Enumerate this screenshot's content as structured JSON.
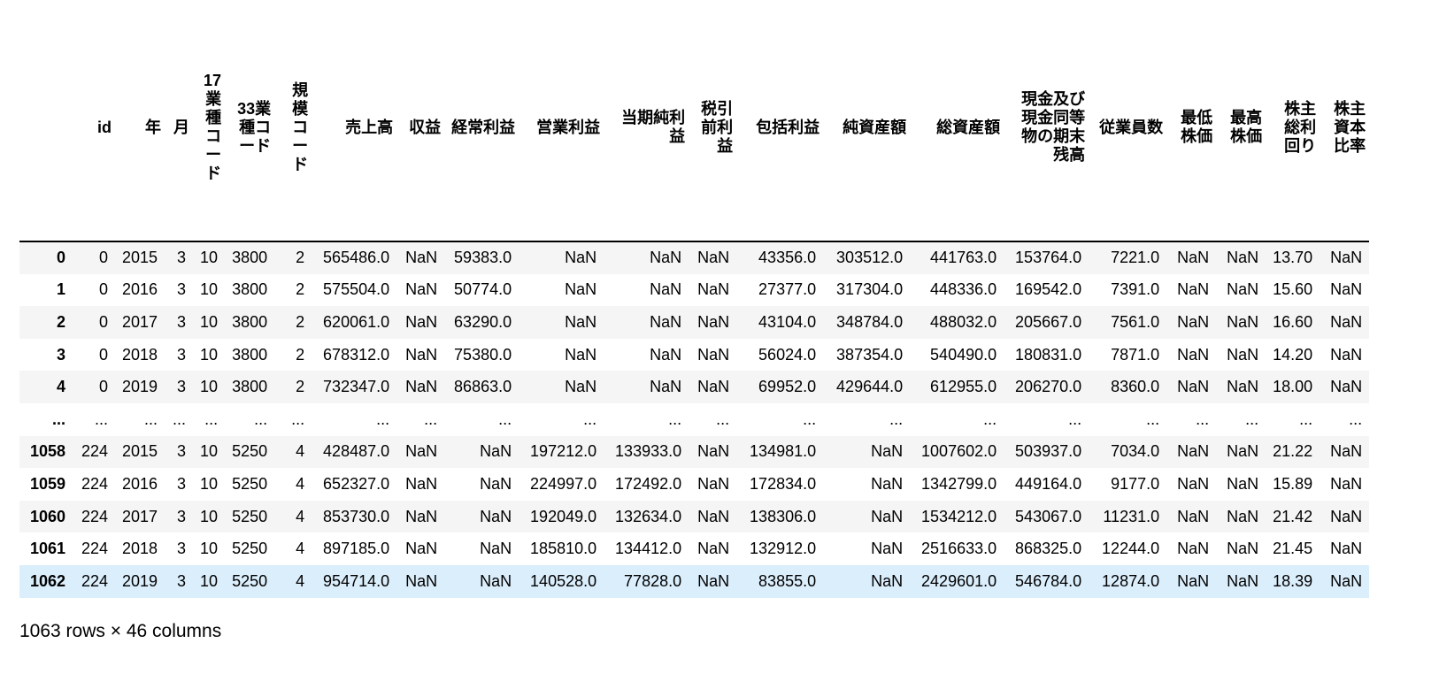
{
  "dataframe": {
    "index_header": "",
    "columns": [
      "id",
      "年",
      "月",
      "17業種コード",
      "33業種コード",
      "規模コード",
      "売上高",
      "収益",
      "経常利益",
      "営業利益",
      "当期純利益",
      "税引前利益",
      "包括利益",
      "純資産額",
      "総資産額",
      "現金及び現金同等物の期末残高",
      "従業員数",
      "最低株価",
      "最高株価",
      "株主総利回り",
      "株主資本比率"
    ],
    "rows": [
      {
        "index": "0",
        "cells": [
          "0",
          "2015",
          "3",
          "10",
          "3800",
          "2",
          "565486.0",
          "NaN",
          "59383.0",
          "NaN",
          "NaN",
          "NaN",
          "43356.0",
          "303512.0",
          "441763.0",
          "153764.0",
          "7221.0",
          "NaN",
          "NaN",
          "13.70",
          "NaN"
        ]
      },
      {
        "index": "1",
        "cells": [
          "0",
          "2016",
          "3",
          "10",
          "3800",
          "2",
          "575504.0",
          "NaN",
          "50774.0",
          "NaN",
          "NaN",
          "NaN",
          "27377.0",
          "317304.0",
          "448336.0",
          "169542.0",
          "7391.0",
          "NaN",
          "NaN",
          "15.60",
          "NaN"
        ]
      },
      {
        "index": "2",
        "cells": [
          "0",
          "2017",
          "3",
          "10",
          "3800",
          "2",
          "620061.0",
          "NaN",
          "63290.0",
          "NaN",
          "NaN",
          "NaN",
          "43104.0",
          "348784.0",
          "488032.0",
          "205667.0",
          "7561.0",
          "NaN",
          "NaN",
          "16.60",
          "NaN"
        ]
      },
      {
        "index": "3",
        "cells": [
          "0",
          "2018",
          "3",
          "10",
          "3800",
          "2",
          "678312.0",
          "NaN",
          "75380.0",
          "NaN",
          "NaN",
          "NaN",
          "56024.0",
          "387354.0",
          "540490.0",
          "180831.0",
          "7871.0",
          "NaN",
          "NaN",
          "14.20",
          "NaN"
        ]
      },
      {
        "index": "4",
        "cells": [
          "0",
          "2019",
          "3",
          "10",
          "3800",
          "2",
          "732347.0",
          "NaN",
          "86863.0",
          "NaN",
          "NaN",
          "NaN",
          "69952.0",
          "429644.0",
          "612955.0",
          "206270.0",
          "8360.0",
          "NaN",
          "NaN",
          "18.00",
          "NaN"
        ]
      },
      {
        "index": "...",
        "cells": [
          "...",
          "...",
          "...",
          "...",
          "...",
          "...",
          "...",
          "...",
          "...",
          "...",
          "...",
          "...",
          "...",
          "...",
          "...",
          "...",
          "...",
          "...",
          "...",
          "...",
          "..."
        ]
      },
      {
        "index": "1058",
        "cells": [
          "224",
          "2015",
          "3",
          "10",
          "5250",
          "4",
          "428487.0",
          "NaN",
          "NaN",
          "197212.0",
          "133933.0",
          "NaN",
          "134981.0",
          "NaN",
          "1007602.0",
          "503937.0",
          "7034.0",
          "NaN",
          "NaN",
          "21.22",
          "NaN"
        ]
      },
      {
        "index": "1059",
        "cells": [
          "224",
          "2016",
          "3",
          "10",
          "5250",
          "4",
          "652327.0",
          "NaN",
          "NaN",
          "224997.0",
          "172492.0",
          "NaN",
          "172834.0",
          "NaN",
          "1342799.0",
          "449164.0",
          "9177.0",
          "NaN",
          "NaN",
          "15.89",
          "NaN"
        ]
      },
      {
        "index": "1060",
        "cells": [
          "224",
          "2017",
          "3",
          "10",
          "5250",
          "4",
          "853730.0",
          "NaN",
          "NaN",
          "192049.0",
          "132634.0",
          "NaN",
          "138306.0",
          "NaN",
          "1534212.0",
          "543067.0",
          "11231.0",
          "NaN",
          "NaN",
          "21.42",
          "NaN"
        ]
      },
      {
        "index": "1061",
        "cells": [
          "224",
          "2018",
          "3",
          "10",
          "5250",
          "4",
          "897185.0",
          "NaN",
          "NaN",
          "185810.0",
          "134412.0",
          "NaN",
          "132912.0",
          "NaN",
          "2516633.0",
          "868325.0",
          "12244.0",
          "NaN",
          "NaN",
          "21.45",
          "NaN"
        ]
      },
      {
        "index": "1062",
        "cells": [
          "224",
          "2019",
          "3",
          "10",
          "5250",
          "4",
          "954714.0",
          "NaN",
          "NaN",
          "140528.0",
          "77828.0",
          "NaN",
          "83855.0",
          "NaN",
          "2429601.0",
          "546784.0",
          "12874.0",
          "NaN",
          "NaN",
          "18.39",
          "NaN"
        ]
      }
    ],
    "selected_row_index": 10,
    "shape_text": "1063 rows × 46 columns",
    "colors": {
      "odd_row": "#f5f5f5",
      "even_row": "#ffffff",
      "hover_row": "#dbeefc",
      "header_rule": "#000000"
    }
  }
}
